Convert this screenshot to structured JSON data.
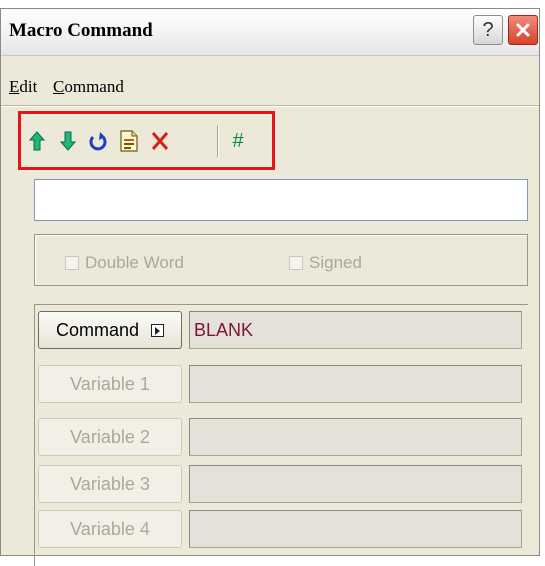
{
  "window": {
    "title": "Macro Command",
    "help_glyph": "?"
  },
  "menu": {
    "items": [
      {
        "label_first": "E",
        "label_rest": "dit"
      },
      {
        "label_first": "C",
        "label_rest": "ommand"
      }
    ]
  },
  "toolbar": {
    "tools": [
      "move-up-icon",
      "move-down-icon",
      "undo-icon",
      "document-icon",
      "delete-icon",
      "hash-icon"
    ],
    "hash_label": "#",
    "highlight_color": "#e8141b"
  },
  "command_text": {
    "value": ""
  },
  "options": {
    "double_word": "Double Word",
    "signed": "Signed"
  },
  "command_panel": {
    "command_label": "Command",
    "command_value": "BLANK",
    "variables": [
      {
        "label": "Variable 1",
        "value": ""
      },
      {
        "label": "Variable 2",
        "value": ""
      },
      {
        "label": "Variable 3",
        "value": ""
      },
      {
        "label": "Variable 4",
        "value": ""
      }
    ]
  },
  "colors": {
    "window_bg": "#ece9d8",
    "command_value": "#7a1630",
    "hash": "#0c8c3c"
  }
}
